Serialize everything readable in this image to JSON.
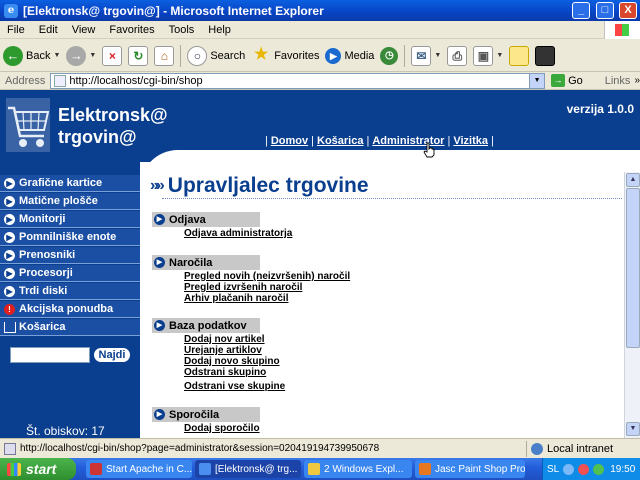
{
  "window": {
    "title": "[Elektronsk@ trgovin@] - Microsoft Internet Explorer",
    "minimize": "_",
    "maximize": "□",
    "close": "X"
  },
  "menu": [
    "File",
    "Edit",
    "View",
    "Favorites",
    "Tools",
    "Help"
  ],
  "toolbar": {
    "back": "Back",
    "search": "Search",
    "favorites": "Favorites",
    "media": "Media"
  },
  "address": {
    "label": "Address",
    "url": "http://localhost/cgi-bin/shop",
    "go": "Go",
    "links": "Links"
  },
  "header": {
    "logo_line1": "Elektronsk@",
    "logo_line2": "trgovin@",
    "version": "verzija 1.0.0",
    "nav": [
      "Domov",
      "Košarica",
      "Administrator",
      "Vizitka"
    ],
    "nav_separator": "|"
  },
  "sidebar": {
    "items": [
      {
        "label": "Grafične kartice",
        "icon": "arrow-bullet-icon"
      },
      {
        "label": "Matične plošče",
        "icon": "arrow-bullet-icon"
      },
      {
        "label": "Monitorji",
        "icon": "arrow-bullet-icon"
      },
      {
        "label": "Pomnilniške enote",
        "icon": "arrow-bullet-icon"
      },
      {
        "label": "Prenosniki",
        "icon": "arrow-bullet-icon"
      },
      {
        "label": "Procesorji",
        "icon": "arrow-bullet-icon"
      },
      {
        "label": "Trdi diski",
        "icon": "arrow-bullet-icon"
      },
      {
        "label": "Akcijska ponudba",
        "icon": "alert-icon"
      },
      {
        "label": "Košarica",
        "icon": "cart-icon"
      }
    ],
    "search_value": "",
    "search_button": "Najdi",
    "visits": "Št. obiskov: 17"
  },
  "main": {
    "title_arrows": "»»",
    "title": "Upravljalec trgovine",
    "sections": [
      {
        "title": "Odjava",
        "links": [
          "Odjava administratorja"
        ]
      },
      {
        "title": "Naročila",
        "links": [
          "Pregled novih (neizvršenih) naročil",
          "Pregled izvršenih naročil",
          "Arhiv plačanih naročil"
        ]
      },
      {
        "title": "Baza podatkov",
        "links": [
          "Dodaj nov artikel",
          "Urejanje artiklov",
          "Dodaj novo skupino",
          "Odstrani skupino",
          "Odstrani vse skupine"
        ]
      },
      {
        "title": "Sporočila",
        "links": [
          "Dodaj sporočilo"
        ]
      }
    ]
  },
  "status": {
    "text": "http://localhost/cgi-bin/shop?page=administrator&session=020419194739950678",
    "zone": "Local intranet"
  },
  "taskbar": {
    "start": "start",
    "tasks": [
      "Start Apache in C...",
      "[Elektronsk@ trg...",
      "2 Windows Expl...",
      "Jasc Paint Shop Pro"
    ],
    "lang": "SL",
    "clock": "19:50"
  },
  "colors": {
    "brand_blue": "#0a3e8e",
    "sidebar_item": "#1a4fa3",
    "section_bg": "#c8c8c8"
  }
}
